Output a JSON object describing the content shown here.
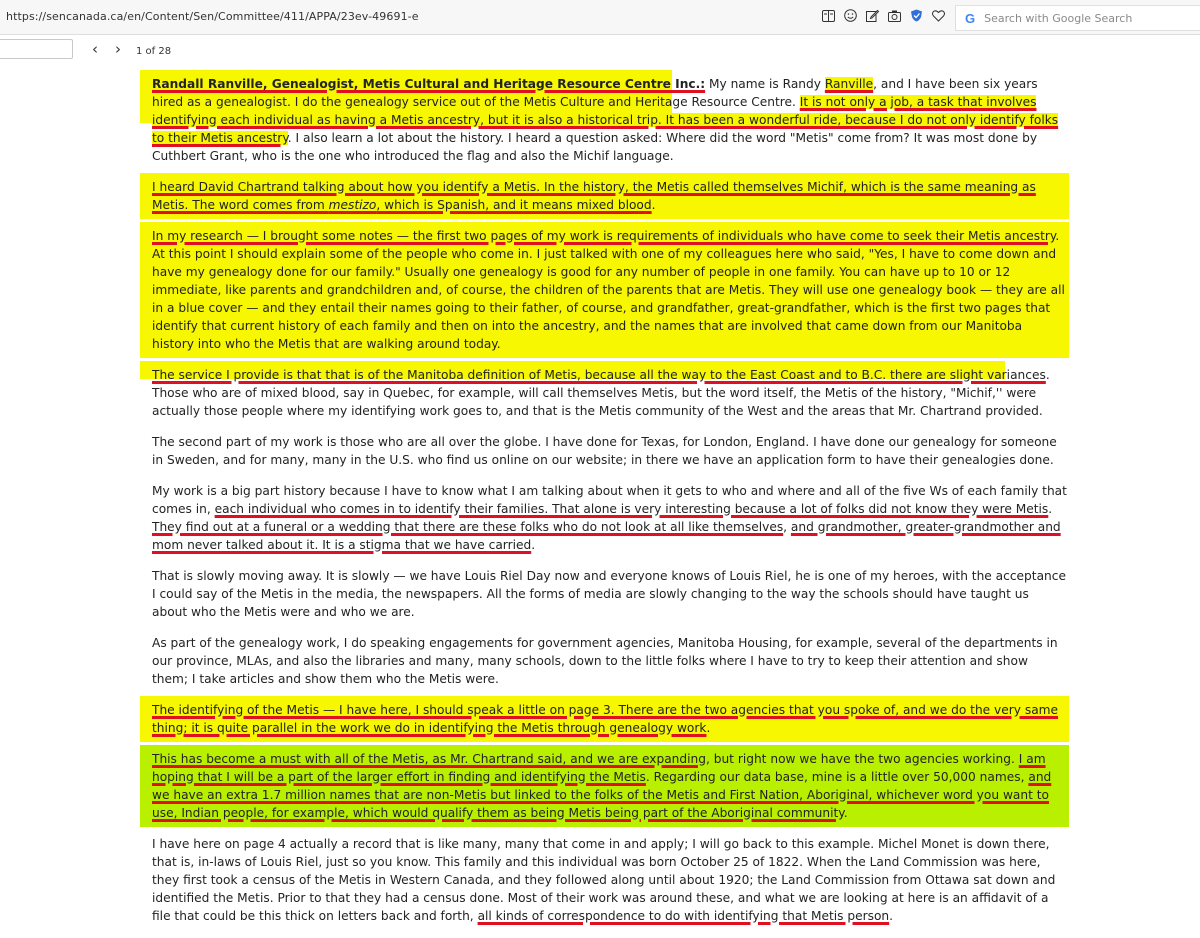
{
  "browser": {
    "url": "https://sencanada.ca/en/Content/Sen/Committee/411/APPA/23ev-49691-e",
    "search_placeholder": "Search with Google Search",
    "icons": [
      "reader-view-icon",
      "smiley-icon",
      "edit-icon",
      "camera-icon",
      "shield-icon",
      "heart-icon"
    ]
  },
  "pdf_toolbar": {
    "page_input_value": "",
    "prev_symbol": "‹",
    "next_symbol": "›",
    "page_count": "1 of 28"
  },
  "document": {
    "cut_top": "... ..... .",
    "p1": {
      "speaker": "Randall Ranville, Genealogist, Metis Cultural and Heritage Resource Centre Inc.:",
      "t1": " My name is Randy ",
      "name_hl": "Ranville",
      "t2": ", and I have been six years hired as a genealogist. I do the genealogy service out of the Metis Culture and Heritage Resource Centre. ",
      "u1": "It is not only a job, a task that involves identifying each individual as having a Metis ancestry, but it is also a historical trip. It has been a wonderful ride, because I do not only identify folks to their Metis ancestry",
      "t3": ". I also learn a lot about the history. I heard a question asked: Where did the word \"Metis\" come from? It was most done by Cuthbert Grant, who is the one who introduced the flag and also the Michif language."
    },
    "p2": {
      "u1": "I heard David Chartrand talking about how you identify a Metis. In the history, the Metis called themselves Michif, which is the same meaning as Metis. The word comes from ",
      "italic": "mestizo",
      "u2": ", which is Spanish, and it means mixed blood",
      "t1": "."
    },
    "p3": {
      "u1": "In my research — I brought some notes — the first two pages of my work is requirements of individuals who have come to seek their Metis ancestry",
      "t1": ". At this point I should explain some of the people who come in. I just talked with one of my colleagues here who said, \"Yes, I have to come down and have my genealogy done for our family.\" Usually one genealogy is good for any number of people in one family. You can have up to 10 or 12 immediate, like parents and grandchildren and, of course, the children of the parents that are Metis. They will use one genealogy book — they are all in a blue cover — and they entail their names going to their father, of course, and grandfather, great-grandfather, which is the first two pages that identify that current history of each family and then on into the ancestry, and the names that are involved that came down from our Manitoba history into who the Metis that are walking around today."
    },
    "p4": {
      "u1": "The service I provide is that that is of the Manitoba definition of Metis, because all the way to the East Coast and to B.C. there are slight variances",
      "t1": ". Those who are of mixed blood, say in Quebec, for example, will call themselves Metis, but the word itself, the Metis of the history, \"Michif,'' were actually those people where my identifying work goes to, and that is the Metis community of the West and the areas that Mr. Chartrand provided."
    },
    "p5": {
      "t1": "The second part of my work is those who are all over the globe. I have done for Texas, for London, England. I have done our genealogy for someone in Sweden, and for many, many in the U.S. who find us online on our website; in there we have an application form to have their genealogies done."
    },
    "p6": {
      "t1": "My work is a big part history because I have to know what I am talking about when it gets to who and where and all of the five Ws of each family that comes in, ",
      "u1": "each individual who comes in to identify their families. That alone is very interesting because a lot of folks did not know they were Metis",
      "t2": ". ",
      "u2": "They find out at a funeral or a wedding that there are these folks who do not look at all like themselves",
      "t3": ", ",
      "u3": "and grandmother, greater-grandmother and mom never talked about it. It is a stigma that we have carried",
      "t4": "."
    },
    "p7": {
      "t1": "That is slowly moving away. It is slowly — we have Louis Riel Day now and everyone knows of Louis Riel, he is one of my heroes, with the acceptance I could say of the Metis in the media, the newspapers. All the forms of media are slowly changing to the way the schools should have taught us about who the Metis were and who we are."
    },
    "p8": {
      "t1": "As part of the genealogy work, I do speaking engagements for government agencies, Manitoba Housing, for example, several of the departments in our province, MLAs, and also the libraries and many, many schools, down to the little folks where I have to try to keep their attention and show them; I take articles and show them who the Metis were."
    },
    "p9": {
      "u1": "The identifying of the Metis — I have here, I should speak a little on page 3. There are the two agencies that you spoke of, and we do the very same thing; it is quite parallel in the work we do in identifying the Metis through genealogy work",
      "t1": "."
    },
    "p10": {
      "u1": "This has become a must with all of the Metis, as Mr. Chartrand said, and we are expanding",
      "t1": ", but right now we have the two agencies working. ",
      "u2": "I am hoping that I will be a part of the larger effort in finding and identifying the Metis",
      "t2": ". Regarding our data base, mine is a little over 50,000 names, ",
      "u3": "and we have an extra 1.7 million names that are non-Metis but linked to the folks of the Metis and First Nation, Aboriginal, whichever word you want to use, Indian people, for example, which would qualify them as being Metis being part of the Aboriginal community",
      "t3": "."
    },
    "p11": {
      "t1": "I have here on page 4 actually a record that is like many, many that come in and apply; I will go back to this example. Michel Monet is down there, that is, in-laws of Louis Riel, just so you know. This family and this individual was born October 25 of 1822. When the Land Commission was here, they first took a census of the Metis in Western Canada, and they followed along until about 1920; the Land Commission from Ottawa sat down and identified the Metis. Prior to that they had a census done. Most of their work was around these, and what we are looking at here is an affidavit of a file that could be this thick on letters back and forth, ",
      "u1": "all kinds of correspondence to do with identifying that Metis person",
      "t2": "."
    }
  },
  "colors": {
    "highlight_yellow": "#f6f700",
    "highlight_green": "#b9f000",
    "underline_red": "#e01020"
  }
}
